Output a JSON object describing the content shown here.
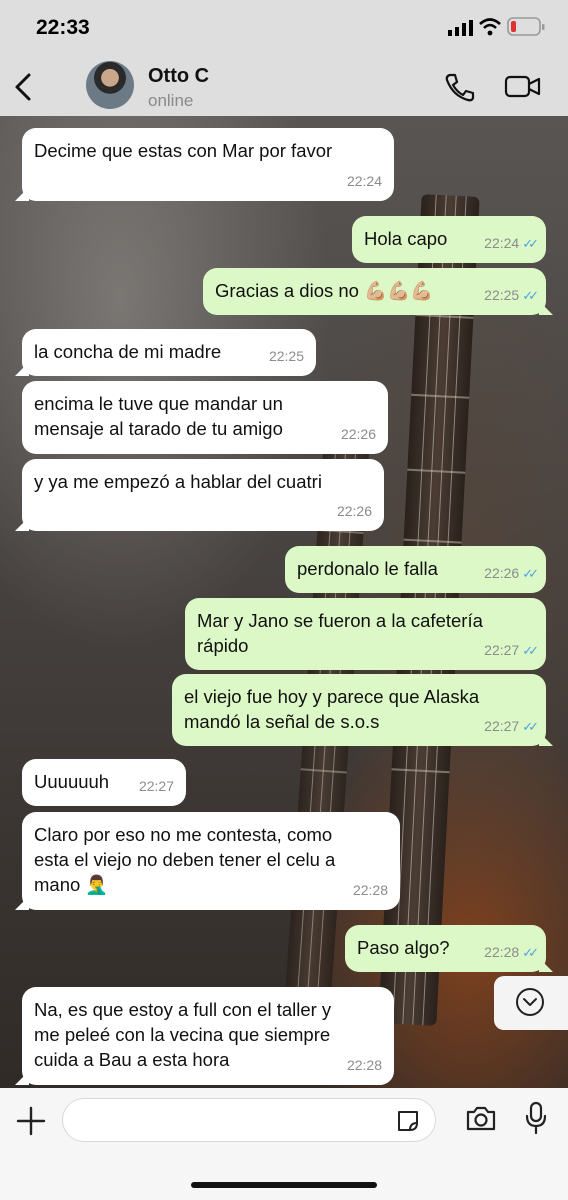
{
  "status_bar": {
    "time": "22:33"
  },
  "header": {
    "contact_name": "Otto C",
    "contact_status": "online"
  },
  "messages": [
    {
      "dir": "in",
      "text": "Decime que estas con Mar por favor",
      "time": "22:24"
    },
    {
      "dir": "out",
      "text": "Hola capo",
      "time": "22:24",
      "read": true
    },
    {
      "dir": "out",
      "text": "Gracias a dios no 💪🏼💪🏼💪🏼",
      "time": "22:25",
      "read": true
    },
    {
      "dir": "in",
      "text": "la concha de mi madre",
      "time": "22:25"
    },
    {
      "dir": "in",
      "text": "encima le tuve que mandar un\nmensaje al tarado de tu amigo",
      "time": "22:26"
    },
    {
      "dir": "in",
      "text": "y ya me empezó a hablar del cuatri",
      "time": "22:26"
    },
    {
      "dir": "out",
      "text": "perdonalo le falla",
      "time": "22:26",
      "read": true
    },
    {
      "dir": "out",
      "text": "Mar y Jano se fueron a la cafetería\nrápido",
      "time": "22:27",
      "read": true
    },
    {
      "dir": "out",
      "text": "el viejo fue hoy y parece que Alaska\nmandó la señal de s.o.s",
      "time": "22:27",
      "read": true
    },
    {
      "dir": "in",
      "text": "Uuuuuuh",
      "time": "22:27"
    },
    {
      "dir": "in",
      "text": "Claro por eso no me contesta, como\nesta el viejo no deben tener el celu a\nmano 🤦‍♂️",
      "time": "22:28"
    },
    {
      "dir": "out",
      "text": "Paso algo?",
      "time": "22:28",
      "read": true
    },
    {
      "dir": "in",
      "text": "Na, es que estoy a full con el taller y\nme peleé con la vecina que siempre\ncuida a Bau a esta hora",
      "time": "22:28"
    }
  ],
  "ticks_glyph": "✓✓",
  "colors": {
    "incoming": "#ffffff",
    "outgoing": "#dcf8c6",
    "read_ticks": "#4fa3e0",
    "header_bg": "#dedede"
  },
  "icons": [
    "back-arrow-icon",
    "phone-icon",
    "video-call-icon",
    "chevron-down-icon",
    "plus-icon",
    "sticker-icon",
    "camera-icon",
    "microphone-icon",
    "signal-icon",
    "wifi-icon",
    "battery-icon"
  ]
}
